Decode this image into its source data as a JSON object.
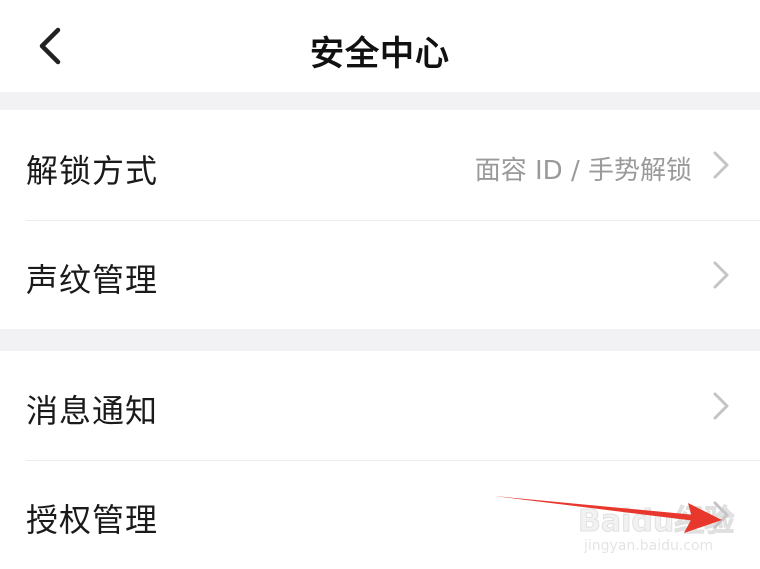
{
  "header": {
    "title": "安全中心",
    "back_icon": "chevron-left-icon"
  },
  "rows": [
    {
      "label": "解锁方式",
      "value": "面容 ID / 手势解锁",
      "icon": "chevron-right-icon"
    },
    {
      "label": "声纹管理",
      "value": "",
      "icon": "chevron-right-icon"
    },
    {
      "label": "消息通知",
      "value": "",
      "icon": "chevron-right-icon"
    },
    {
      "label": "授权管理",
      "value": "",
      "icon": "chevron-right-icon"
    }
  ],
  "annotation": {
    "arrow_color": "#e8372d"
  },
  "watermark": {
    "brand": "Baidu经验",
    "url": "jingyan.baidu.com"
  },
  "colors": {
    "background": "#ffffff",
    "separator_band": "#f2f2f4",
    "text_primary": "#1a1a1a",
    "text_secondary": "#9a9a9a",
    "chevron": "#c4c4c4"
  }
}
